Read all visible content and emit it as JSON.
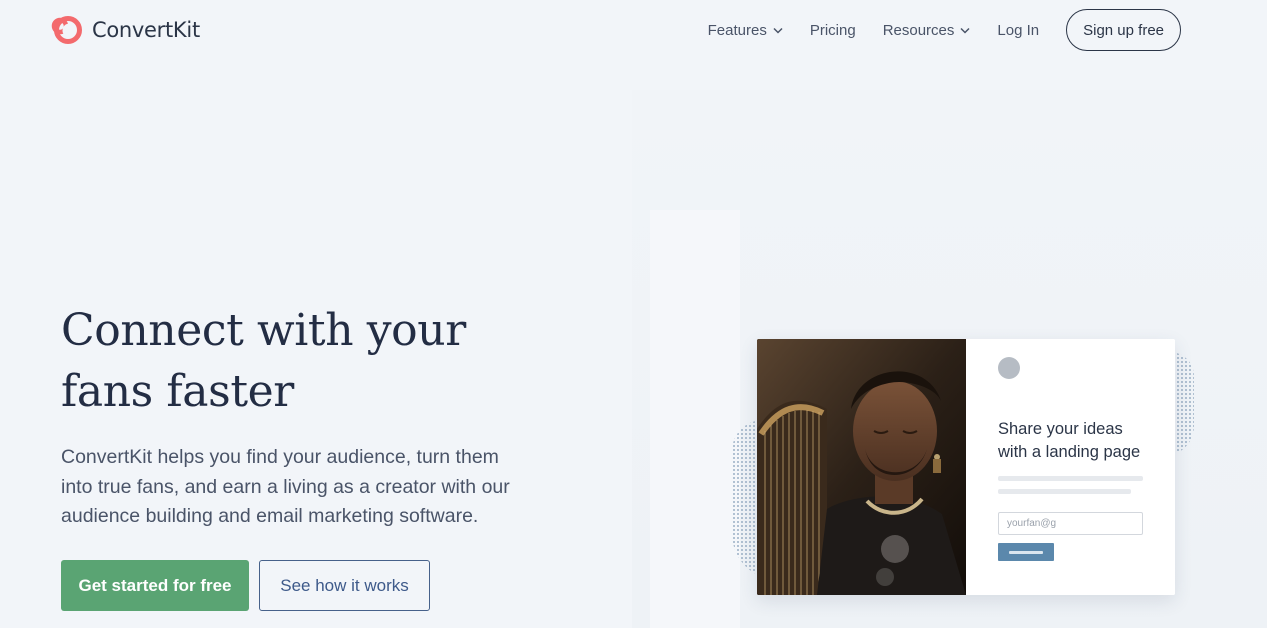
{
  "brand": {
    "name": "ConvertKit",
    "logo_icon": "convertkit-logo-icon",
    "logo_color": "#f36a6d"
  },
  "nav": {
    "items": [
      {
        "label": "Features",
        "has_dropdown": true,
        "icon": "chevron-down-icon"
      },
      {
        "label": "Pricing",
        "has_dropdown": false
      },
      {
        "label": "Resources",
        "has_dropdown": true,
        "icon": "chevron-down-icon"
      },
      {
        "label": "Log In",
        "has_dropdown": false
      }
    ],
    "signup_label": "Sign up free"
  },
  "hero": {
    "title_line1": "Connect with your",
    "title_line2": "fans faster",
    "description": "ConvertKit helps you find your audience, turn them into true fans, and earn a living as a creator with our audience building and email marketing software.",
    "primary_cta": "Get started for free",
    "secondary_cta": "See how it works"
  },
  "preview_card": {
    "heading_line1": "Share your ideas",
    "heading_line2": "with a landing page",
    "email_placeholder": "yourfan@g"
  },
  "colors": {
    "background": "#f2f5f9",
    "primary_button": "#5aa473",
    "secondary_button_border": "#46618a",
    "heading": "#232d44",
    "card_submit": "#5b88ac"
  }
}
